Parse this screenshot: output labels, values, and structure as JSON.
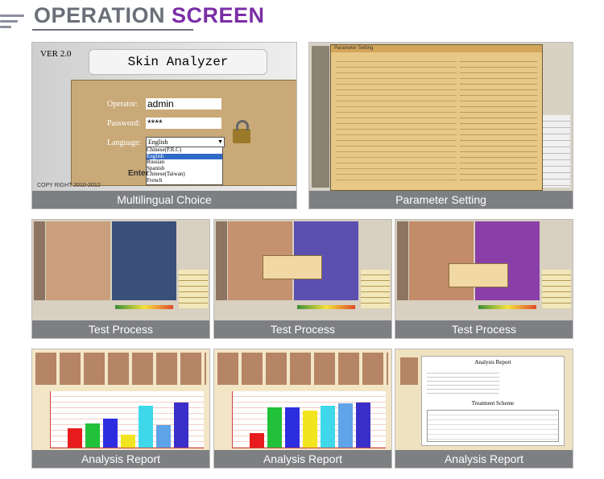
{
  "header": {
    "title_part1": "OPERATION",
    "title_part2": "SCREEN"
  },
  "colors": {
    "title_gray": "#6b6f78",
    "title_purple": "#7a2ea6",
    "caption_bg": "#7d7f82",
    "software_bg": "#c8a96a"
  },
  "panels": {
    "multilingual": {
      "caption": "Multilingual Choice",
      "version": "VER 2.0",
      "app_title": "Skin Analyzer",
      "operator_label": "Operator:",
      "operator_value": "admin",
      "password_label": "Password:",
      "password_value": "****",
      "language_label": "Language:",
      "language_selected": "English",
      "language_options": [
        "Chinese(P.R.C)",
        "English",
        "Russian",
        "Spanish",
        "Chinese(Taiwan)",
        "French"
      ],
      "enter_label": "Enter",
      "copyright": "COPY RIGHT 2010-2012"
    },
    "parameter": {
      "caption": "Parameter Setting",
      "dialog_title": "Parameter Setting"
    },
    "test1": {
      "caption": "Test Process"
    },
    "test2": {
      "caption": "Test Process"
    },
    "test3": {
      "caption": "Test Process"
    },
    "report1": {
      "caption": "Analysis Report"
    },
    "report2": {
      "caption": "Analysis Report"
    },
    "report3": {
      "caption": "Analysis Report",
      "report_title": "Analysis Report",
      "scheme_title": "Treatment Scheme"
    }
  }
}
